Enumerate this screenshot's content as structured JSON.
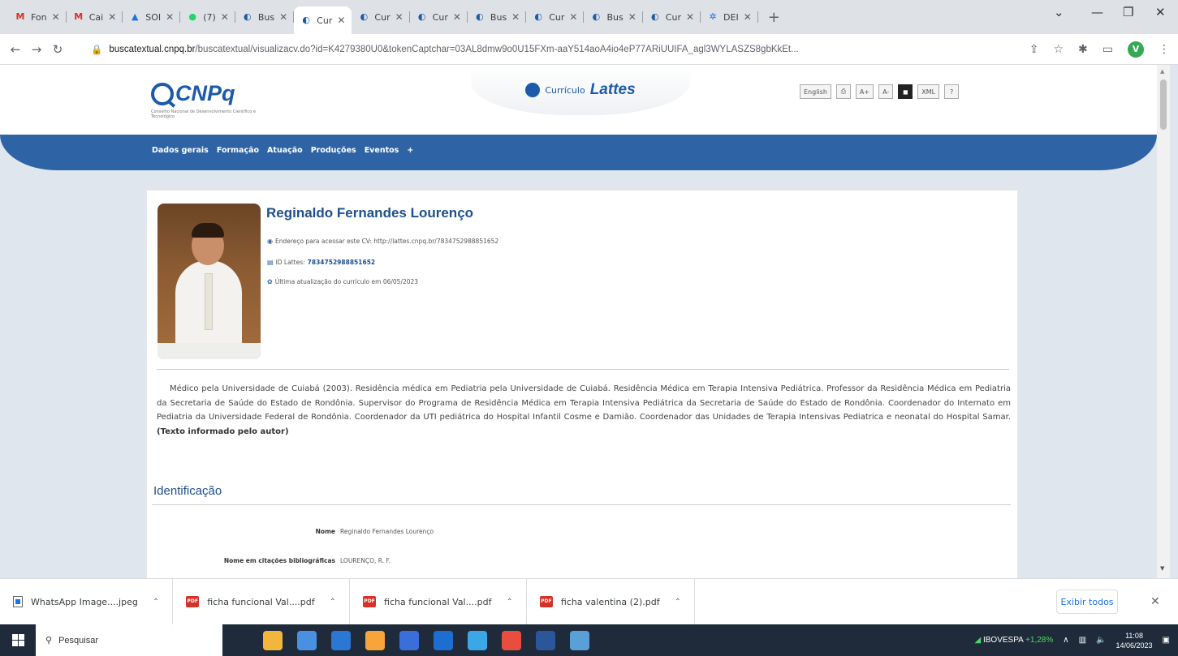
{
  "browser": {
    "tabs": [
      {
        "favicon": "gmail-icon",
        "label": "Fon",
        "color": "#d93025",
        "glyph": "M"
      },
      {
        "favicon": "gmail-icon",
        "label": "Cai",
        "color": "#d93025",
        "glyph": "M"
      },
      {
        "favicon": "drive-icon",
        "label": "SOI",
        "color": "#1a73e8",
        "glyph": "▲"
      },
      {
        "favicon": "whatsapp-icon",
        "label": "(7)",
        "color": "#25d366",
        "glyph": "●"
      },
      {
        "favicon": "lattes-icon",
        "label": "Bus",
        "color": "#1d5ba8",
        "glyph": "◐"
      },
      {
        "favicon": "lattes-icon",
        "label": "Cur",
        "color": "#1d5ba8",
        "glyph": "◐",
        "active": true
      },
      {
        "favicon": "lattes-icon",
        "label": "Cur",
        "color": "#1d5ba8",
        "glyph": "◐"
      },
      {
        "favicon": "lattes-icon",
        "label": "Cur",
        "color": "#1d5ba8",
        "glyph": "◐"
      },
      {
        "favicon": "lattes-icon",
        "label": "Bus",
        "color": "#1d5ba8",
        "glyph": "◐"
      },
      {
        "favicon": "lattes-icon",
        "label": "Cur",
        "color": "#1d5ba8",
        "glyph": "◐"
      },
      {
        "favicon": "lattes-icon",
        "label": "Bus",
        "color": "#1d5ba8",
        "glyph": "◐"
      },
      {
        "favicon": "lattes-icon",
        "label": "Cur",
        "color": "#1d5ba8",
        "glyph": "◐"
      },
      {
        "favicon": "dei-icon",
        "label": "DEI",
        "color": "#1a73e8",
        "glyph": "✲"
      }
    ],
    "url_host": "buscatextual.cnpq.br",
    "url_path": "/buscatextual/visualizacv.do?id=K4279380U0&tokenCaptchar=03AL8dmw9o0U15FXm-aaY514aoA4io4eP77ARiUUIFA_agl3WYLASZS8gbKkEt..."
  },
  "site": {
    "logo_text": "CNPq",
    "logo_sub": "Conselho Nacional de Desenvolvimento Científico e Tecnológico",
    "lattes_small": "Currículo",
    "lattes_big": "Lattes",
    "tools": {
      "english": "English",
      "xml": "XML",
      "help": "?",
      "a_plus": "A+",
      "a_minus": "A-"
    },
    "menu": [
      "Dados gerais",
      "Formação",
      "Atuação",
      "Produções",
      "Eventos",
      "+"
    ]
  },
  "cv": {
    "name": "Reginaldo Fernandes Lourenço",
    "url_line": "Endereço para acessar este CV: http://lattes.cnpq.br/7834752988851652",
    "id_label": "ID Lattes:",
    "id_value": "7834752988851652",
    "update_line": "Última atualização do currículo em 06/05/2023",
    "resumo": "Médico pela Universidade de Cuiabá (2003). Residência médica em Pediatria pela Universidade de Cuiabá. Residência Médica em Terapia Intensiva Pediátrica. Professor da Residência Médica em Pediatria da Secretaria de Saúde do Estado de Rondônia. Supervisor do Programa de Residência Médica em Terapia Intensiva Pediátrica da Secretaria de Saúde do Estado de Rondônia. Coordenador do Internato em Pediatria da Universidade Federal de Rondônia. Coordenador da UTI pediátrica do Hospital Infantil Cosme e Damião. Coordenador das Unidades de Terapia Intensivas Pediatrica e neonatal do Hospital Samar.",
    "resumo_note": "(Texto informado pelo autor)",
    "section_title": "Identificação",
    "fields": [
      {
        "label": "Nome",
        "value": "Reginaldo Fernandes Lourenço"
      },
      {
        "label": "Nome em citações bibliográficas",
        "value": "LOURENÇO, R. F."
      }
    ]
  },
  "downloads": {
    "items": [
      {
        "kind": "image",
        "name": "WhatsApp Image....jpeg"
      },
      {
        "kind": "pdf",
        "name": "ficha funcional Val....pdf"
      },
      {
        "kind": "pdf",
        "name": "ficha funcional Val....pdf"
      },
      {
        "kind": "pdf",
        "name": "ficha valentina (2).pdf"
      }
    ],
    "show_all": "Exibir todos"
  },
  "taskbar": {
    "search_placeholder": "Pesquisar",
    "ibov_label": "IBOVESPA",
    "ibov_change": "+1,28%",
    "time": "11:08",
    "date": "14/06/2023",
    "app_colors": [
      "#f2b63c",
      "#4a90e2",
      "#2b78d4",
      "#f7a43a",
      "#3a6ed8",
      "#1c6fd1",
      "#3ba7e6",
      "#e84d3d",
      "#2b579a",
      "#5aa0d8"
    ]
  }
}
